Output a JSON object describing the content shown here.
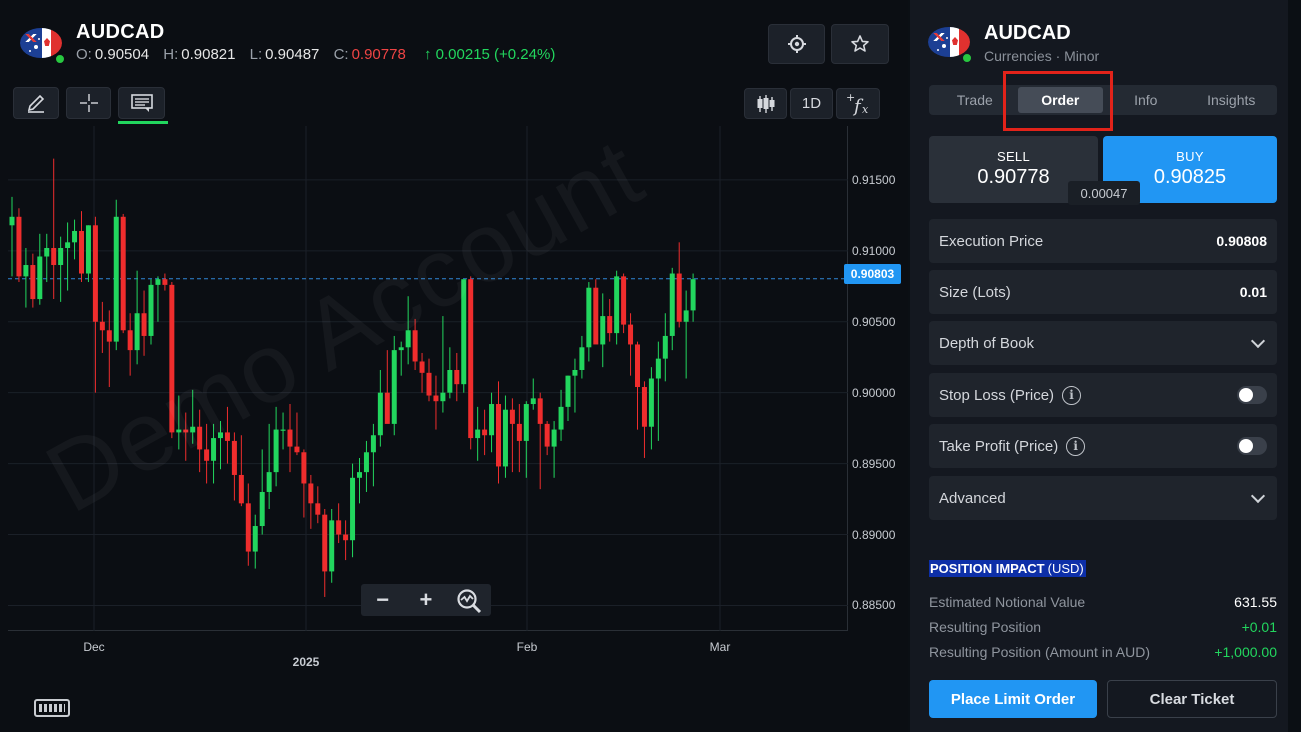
{
  "chart_header": {
    "symbol": "AUDCAD",
    "ohlc": {
      "o_label": "O:",
      "o": "0.90504",
      "h_label": "H:",
      "h": "0.90821",
      "l_label": "L:",
      "l": "0.90487",
      "c_label": "C:",
      "c": "0.90778",
      "change": "↑ 0.00215 (+0.24%)"
    }
  },
  "toolbar": {
    "timeframe": "1D",
    "icons": [
      "pencil-icon",
      "crosshair-icon",
      "chat-bubble-icon",
      "candlestick-icon",
      "fx-icon",
      "target-icon",
      "star-icon"
    ]
  },
  "watermark": "Demo Account",
  "chart_data": {
    "type": "candlestick",
    "y_ticks": [
      "0.91500",
      "0.91000",
      "0.90500",
      "0.90000",
      "0.89500",
      "0.89000",
      "0.88500"
    ],
    "ylim": [
      0.8832,
      0.9188
    ],
    "x_ticks": [
      {
        "label": "Dec",
        "bold": false
      },
      {
        "label": "2025",
        "bold": true
      },
      {
        "label": "Feb",
        "bold": false
      },
      {
        "label": "Mar",
        "bold": false
      }
    ],
    "current_price": "0.90803",
    "up_color": "#22d65e",
    "down_color": "#ef2d2d",
    "candles": [
      {
        "o": 0.9118,
        "h": 0.9138,
        "l": 0.9082,
        "c": 0.9124
      },
      {
        "o": 0.9124,
        "h": 0.913,
        "l": 0.9078,
        "c": 0.9082
      },
      {
        "o": 0.9082,
        "h": 0.9102,
        "l": 0.906,
        "c": 0.909
      },
      {
        "o": 0.909,
        "h": 0.9098,
        "l": 0.906,
        "c": 0.9066
      },
      {
        "o": 0.9066,
        "h": 0.9112,
        "l": 0.9062,
        "c": 0.9096
      },
      {
        "o": 0.9096,
        "h": 0.9112,
        "l": 0.9078,
        "c": 0.9102
      },
      {
        "o": 0.9102,
        "h": 0.9165,
        "l": 0.9066,
        "c": 0.909
      },
      {
        "o": 0.909,
        "h": 0.911,
        "l": 0.9064,
        "c": 0.9102
      },
      {
        "o": 0.9102,
        "h": 0.912,
        "l": 0.9072,
        "c": 0.9106
      },
      {
        "o": 0.9106,
        "h": 0.9122,
        "l": 0.9094,
        "c": 0.9114
      },
      {
        "o": 0.9114,
        "h": 0.9128,
        "l": 0.9078,
        "c": 0.9084
      },
      {
        "o": 0.9084,
        "h": 0.9118,
        "l": 0.9078,
        "c": 0.9118
      },
      {
        "o": 0.9118,
        "h": 0.9124,
        "l": 0.9,
        "c": 0.905
      },
      {
        "o": 0.905,
        "h": 0.9064,
        "l": 0.9028,
        "c": 0.9044
      },
      {
        "o": 0.9044,
        "h": 0.9058,
        "l": 0.9004,
        "c": 0.9036
      },
      {
        "o": 0.9036,
        "h": 0.9136,
        "l": 0.903,
        "c": 0.9124
      },
      {
        "o": 0.9124,
        "h": 0.9126,
        "l": 0.9042,
        "c": 0.9044
      },
      {
        "o": 0.9044,
        "h": 0.9056,
        "l": 0.9012,
        "c": 0.903
      },
      {
        "o": 0.903,
        "h": 0.9086,
        "l": 0.902,
        "c": 0.9056
      },
      {
        "o": 0.9056,
        "h": 0.9072,
        "l": 0.9026,
        "c": 0.904
      },
      {
        "o": 0.904,
        "h": 0.908,
        "l": 0.9034,
        "c": 0.9076
      },
      {
        "o": 0.9076,
        "h": 0.9082,
        "l": 0.905,
        "c": 0.908
      },
      {
        "o": 0.908,
        "h": 0.9084,
        "l": 0.9072,
        "c": 0.9076
      },
      {
        "o": 0.9076,
        "h": 0.9078,
        "l": 0.8968,
        "c": 0.8972
      },
      {
        "o": 0.8972,
        "h": 0.8998,
        "l": 0.896,
        "c": 0.8974
      },
      {
        "o": 0.8974,
        "h": 0.8986,
        "l": 0.8952,
        "c": 0.8972
      },
      {
        "o": 0.8972,
        "h": 0.9002,
        "l": 0.8964,
        "c": 0.8976
      },
      {
        "o": 0.8976,
        "h": 0.8988,
        "l": 0.8944,
        "c": 0.896
      },
      {
        "o": 0.896,
        "h": 0.8978,
        "l": 0.8936,
        "c": 0.8952
      },
      {
        "o": 0.8952,
        "h": 0.8978,
        "l": 0.8936,
        "c": 0.8968
      },
      {
        "o": 0.8968,
        "h": 0.898,
        "l": 0.8946,
        "c": 0.8972
      },
      {
        "o": 0.8972,
        "h": 0.899,
        "l": 0.895,
        "c": 0.8966
      },
      {
        "o": 0.8966,
        "h": 0.8972,
        "l": 0.8924,
        "c": 0.8942
      },
      {
        "o": 0.8942,
        "h": 0.897,
        "l": 0.892,
        "c": 0.8922
      },
      {
        "o": 0.8922,
        "h": 0.8936,
        "l": 0.8878,
        "c": 0.8888
      },
      {
        "o": 0.8888,
        "h": 0.8914,
        "l": 0.8876,
        "c": 0.8906
      },
      {
        "o": 0.8906,
        "h": 0.896,
        "l": 0.89,
        "c": 0.893
      },
      {
        "o": 0.893,
        "h": 0.8978,
        "l": 0.8918,
        "c": 0.8944
      },
      {
        "o": 0.8944,
        "h": 0.899,
        "l": 0.8934,
        "c": 0.8974
      },
      {
        "o": 0.8974,
        "h": 0.8986,
        "l": 0.896,
        "c": 0.8974
      },
      {
        "o": 0.8974,
        "h": 0.8992,
        "l": 0.8944,
        "c": 0.8962
      },
      {
        "o": 0.8962,
        "h": 0.8986,
        "l": 0.8956,
        "c": 0.8958
      },
      {
        "o": 0.8958,
        "h": 0.896,
        "l": 0.8912,
        "c": 0.8936
      },
      {
        "o": 0.8936,
        "h": 0.8942,
        "l": 0.8904,
        "c": 0.8922
      },
      {
        "o": 0.8922,
        "h": 0.8934,
        "l": 0.8908,
        "c": 0.8914
      },
      {
        "o": 0.8914,
        "h": 0.8918,
        "l": 0.8856,
        "c": 0.8874
      },
      {
        "o": 0.8874,
        "h": 0.8918,
        "l": 0.8866,
        "c": 0.891
      },
      {
        "o": 0.891,
        "h": 0.8922,
        "l": 0.8894,
        "c": 0.89
      },
      {
        "o": 0.89,
        "h": 0.891,
        "l": 0.8882,
        "c": 0.8896
      },
      {
        "o": 0.8896,
        "h": 0.895,
        "l": 0.8884,
        "c": 0.894
      },
      {
        "o": 0.894,
        "h": 0.8954,
        "l": 0.8922,
        "c": 0.8944
      },
      {
        "o": 0.8944,
        "h": 0.8966,
        "l": 0.893,
        "c": 0.8958
      },
      {
        "o": 0.8958,
        "h": 0.8978,
        "l": 0.8934,
        "c": 0.897
      },
      {
        "o": 0.897,
        "h": 0.9016,
        "l": 0.8962,
        "c": 0.9
      },
      {
        "o": 0.9,
        "h": 0.903,
        "l": 0.898,
        "c": 0.8978
      },
      {
        "o": 0.8978,
        "h": 0.904,
        "l": 0.897,
        "c": 0.903
      },
      {
        "o": 0.903,
        "h": 0.9036,
        "l": 0.9012,
        "c": 0.9032
      },
      {
        "o": 0.9032,
        "h": 0.9068,
        "l": 0.902,
        "c": 0.9044
      },
      {
        "o": 0.9044,
        "h": 0.9052,
        "l": 0.9016,
        "c": 0.9022
      },
      {
        "o": 0.9022,
        "h": 0.9028,
        "l": 0.9,
        "c": 0.9014
      },
      {
        "o": 0.9014,
        "h": 0.9024,
        "l": 0.8994,
        "c": 0.8998
      },
      {
        "o": 0.8998,
        "h": 0.9012,
        "l": 0.8974,
        "c": 0.8994
      },
      {
        "o": 0.8994,
        "h": 0.9054,
        "l": 0.8986,
        "c": 0.9
      },
      {
        "o": 0.9,
        "h": 0.9032,
        "l": 0.8996,
        "c": 0.9016
      },
      {
        "o": 0.9016,
        "h": 0.9028,
        "l": 0.8994,
        "c": 0.9006
      },
      {
        "o": 0.9006,
        "h": 0.9062,
        "l": 0.9,
        "c": 0.908
      },
      {
        "o": 0.908,
        "h": 0.9082,
        "l": 0.896,
        "c": 0.8968
      },
      {
        "o": 0.8968,
        "h": 0.899,
        "l": 0.8952,
        "c": 0.8974
      },
      {
        "o": 0.8974,
        "h": 0.8988,
        "l": 0.8956,
        "c": 0.897
      },
      {
        "o": 0.897,
        "h": 0.9,
        "l": 0.8958,
        "c": 0.8992
      },
      {
        "o": 0.8992,
        "h": 0.9008,
        "l": 0.8936,
        "c": 0.8948
      },
      {
        "o": 0.8948,
        "h": 0.8998,
        "l": 0.894,
        "c": 0.8988
      },
      {
        "o": 0.8988,
        "h": 0.8996,
        "l": 0.8944,
        "c": 0.8978
      },
      {
        "o": 0.8978,
        "h": 0.8992,
        "l": 0.8944,
        "c": 0.8966
      },
      {
        "o": 0.8966,
        "h": 0.8994,
        "l": 0.894,
        "c": 0.8992
      },
      {
        "o": 0.8992,
        "h": 0.901,
        "l": 0.8988,
        "c": 0.8996
      },
      {
        "o": 0.8996,
        "h": 0.9,
        "l": 0.8932,
        "c": 0.8978
      },
      {
        "o": 0.8978,
        "h": 0.898,
        "l": 0.8956,
        "c": 0.8962
      },
      {
        "o": 0.8962,
        "h": 0.898,
        "l": 0.894,
        "c": 0.8974
      },
      {
        "o": 0.8974,
        "h": 0.9002,
        "l": 0.8966,
        "c": 0.899
      },
      {
        "o": 0.899,
        "h": 0.9012,
        "l": 0.898,
        "c": 0.9012
      },
      {
        "o": 0.9012,
        "h": 0.9024,
        "l": 0.8986,
        "c": 0.9016
      },
      {
        "o": 0.9016,
        "h": 0.904,
        "l": 0.901,
        "c": 0.9032
      },
      {
        "o": 0.9032,
        "h": 0.9078,
        "l": 0.9022,
        "c": 0.9074
      },
      {
        "o": 0.9074,
        "h": 0.908,
        "l": 0.9038,
        "c": 0.9034
      },
      {
        "o": 0.9034,
        "h": 0.907,
        "l": 0.9018,
        "c": 0.9054
      },
      {
        "o": 0.9054,
        "h": 0.9066,
        "l": 0.9036,
        "c": 0.9042
      },
      {
        "o": 0.9042,
        "h": 0.9086,
        "l": 0.9034,
        "c": 0.9082
      },
      {
        "o": 0.9082,
        "h": 0.9084,
        "l": 0.9042,
        "c": 0.9048
      },
      {
        "o": 0.9048,
        "h": 0.9056,
        "l": 0.9012,
        "c": 0.9034
      },
      {
        "o": 0.9034,
        "h": 0.9036,
        "l": 0.8974,
        "c": 0.9004
      },
      {
        "o": 0.9004,
        "h": 0.9008,
        "l": 0.8954,
        "c": 0.8976
      },
      {
        "o": 0.8976,
        "h": 0.9018,
        "l": 0.896,
        "c": 0.901
      },
      {
        "o": 0.901,
        "h": 0.9036,
        "l": 0.8966,
        "c": 0.9024
      },
      {
        "o": 0.9024,
        "h": 0.9056,
        "l": 0.9008,
        "c": 0.904
      },
      {
        "o": 0.904,
        "h": 0.9088,
        "l": 0.903,
        "c": 0.9084
      },
      {
        "o": 0.9084,
        "h": 0.9106,
        "l": 0.9046,
        "c": 0.905
      },
      {
        "o": 0.905,
        "h": 0.9072,
        "l": 0.901,
        "c": 0.9058
      },
      {
        "o": 0.9058,
        "h": 0.9084,
        "l": 0.905,
        "c": 0.908
      }
    ]
  },
  "zoom_controls": {
    "minus": "−",
    "plus": "+"
  },
  "panel": {
    "symbol": "AUDCAD",
    "subtitle": "Currencies · Minor",
    "tabs": [
      {
        "label": "Trade"
      },
      {
        "label": "Order"
      },
      {
        "label": "Info"
      },
      {
        "label": "Insights"
      }
    ],
    "active_tab": "Order",
    "sell_label": "SELL",
    "sell_price": "0.90778",
    "buy_label": "BUY",
    "buy_price": "0.90825",
    "spread": "0.00047",
    "execution_price_label": "Execution Price",
    "execution_price": "0.90808",
    "size_label": "Size (Lots)",
    "size": "0.01",
    "depth_label": "Depth of Book",
    "stop_loss_label": "Stop Loss (Price)",
    "stop_loss_enabled": false,
    "take_profit_label": "Take Profit (Price)",
    "take_profit_enabled": false,
    "advanced_label": "Advanced",
    "impact_title": "POSITION IMPACT",
    "impact_unit": "(USD)",
    "impact": [
      {
        "label": "Estimated Notional Value",
        "value": "631.55",
        "green": false
      },
      {
        "label": "Resulting Position",
        "value": "+0.01",
        "green": true
      },
      {
        "label": "Resulting Position (Amount in AUD)",
        "value": "+1,000.00",
        "green": true
      }
    ],
    "place_order_label": "Place Limit Order",
    "clear_label": "Clear Ticket"
  },
  "colors": {
    "accent": "#2196f3",
    "up": "#22d65e",
    "down": "#ef2d2d",
    "highlight": "#e2231a"
  }
}
